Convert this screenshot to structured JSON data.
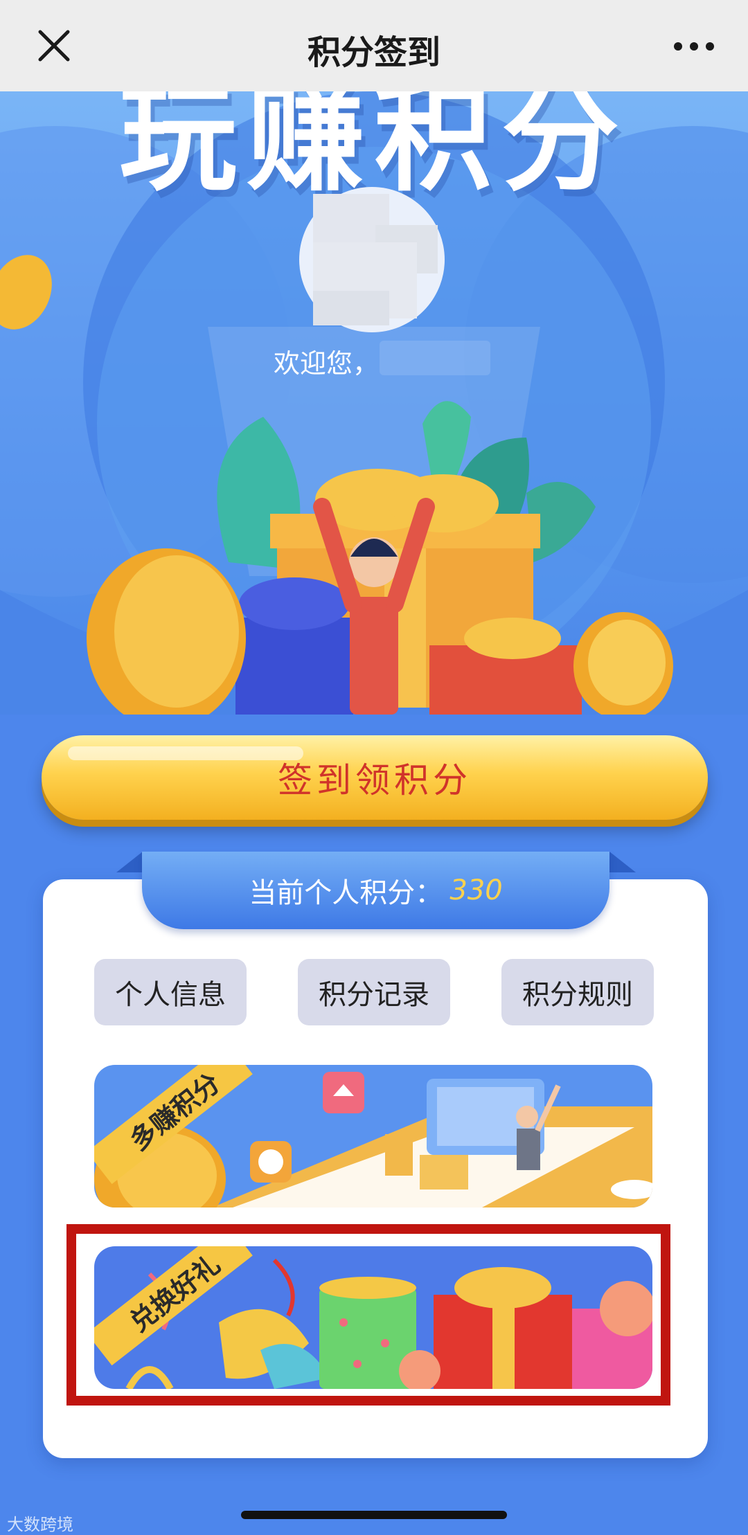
{
  "navbar": {
    "title": "积分签到",
    "close_icon": "close-icon",
    "more_icon": "more-horizontal-icon"
  },
  "hero": {
    "title": "玩赚积分",
    "welcome": "欢迎您，"
  },
  "signin": {
    "label": "签到领积分"
  },
  "points": {
    "label": "当前个人积分：",
    "value": "330"
  },
  "actions": [
    {
      "label": "个人信息"
    },
    {
      "label": "积分记录"
    },
    {
      "label": "积分规则"
    }
  ],
  "banners": [
    {
      "tag": "多赚积分"
    },
    {
      "tag": "兑换好礼"
    }
  ],
  "watermark": "大数跨境",
  "colors": {
    "accent_blue": "#4d86ec",
    "button_gold": "#ffd24d",
    "button_text": "#d0332a",
    "highlight_red": "#c0150f"
  }
}
